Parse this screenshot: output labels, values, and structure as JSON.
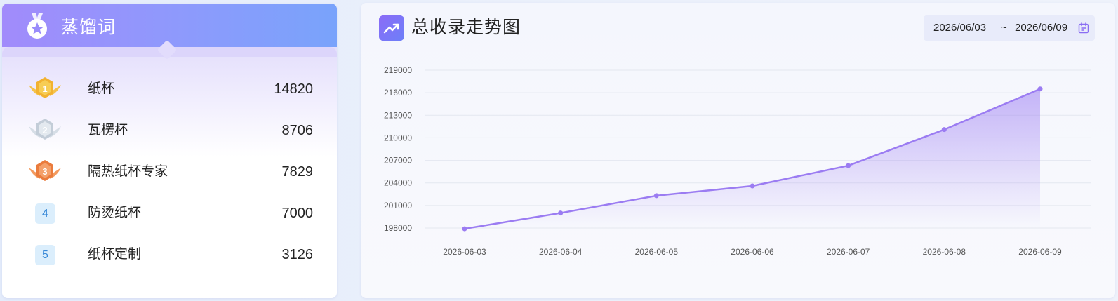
{
  "ranking_panel": {
    "title": "蒸馏词",
    "items": [
      {
        "rank": "1",
        "name": "纸杯",
        "value": "14820"
      },
      {
        "rank": "2",
        "name": "瓦楞杯",
        "value": "8706"
      },
      {
        "rank": "3",
        "name": "隔热纸杯专家",
        "value": "7829"
      },
      {
        "rank": "4",
        "name": "防烫纸杯",
        "value": "7000"
      },
      {
        "rank": "5",
        "name": "纸杯定制",
        "value": "3126"
      }
    ]
  },
  "chart_panel": {
    "title": "总收录走势图",
    "date_start": "2026/06/03",
    "date_separator": "~",
    "date_end": "2026/06/09",
    "icon": "trend-up-icon"
  },
  "colors": {
    "accent": "#9b7cf2",
    "header_gradient_start": "#a18bfb",
    "header_gradient_end": "#79a3fb",
    "gold": "#f2b230",
    "silver": "#c9d3de",
    "bronze": "#ee8448",
    "rank_badge_bg": "#dbeefc",
    "rank_badge_text": "#3a8ad8"
  },
  "chart_data": {
    "type": "area",
    "x": [
      "2026-06-03",
      "2026-06-04",
      "2026-06-05",
      "2026-06-06",
      "2026-06-07",
      "2026-06-08",
      "2026-06-09"
    ],
    "y_ticks": [
      "198000",
      "201000",
      "204000",
      "207000",
      "210000",
      "213000",
      "216000",
      "219000"
    ],
    "ylim": [
      198000,
      219000
    ],
    "series": [
      {
        "values": [
          197900,
          200000,
          202300,
          203600,
          206300,
          211100,
          216500
        ]
      }
    ],
    "grid": true,
    "legend": "none"
  }
}
